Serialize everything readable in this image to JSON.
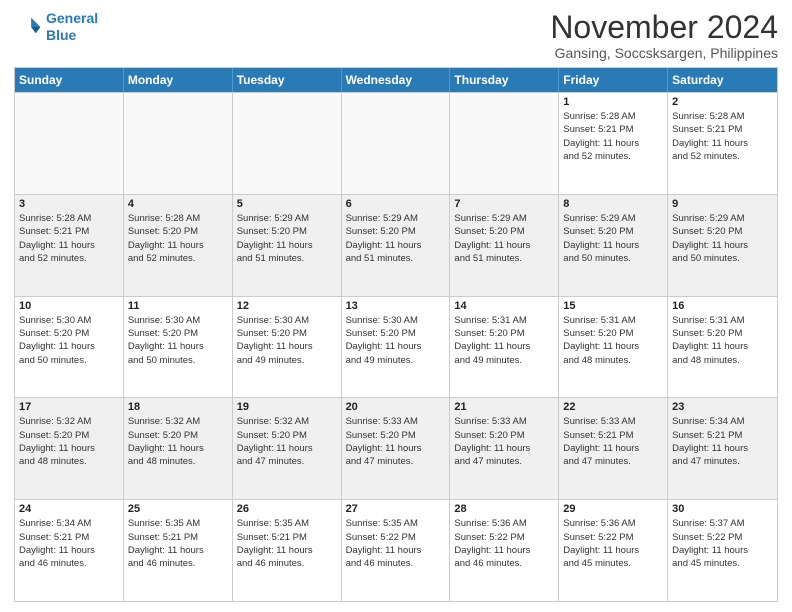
{
  "logo": {
    "line1": "General",
    "line2": "Blue"
  },
  "title": "November 2024",
  "location": "Gansing, Soccsksargen, Philippines",
  "headers": [
    "Sunday",
    "Monday",
    "Tuesday",
    "Wednesday",
    "Thursday",
    "Friday",
    "Saturday"
  ],
  "weeks": [
    [
      {
        "day": "",
        "info": "",
        "empty": true
      },
      {
        "day": "",
        "info": "",
        "empty": true
      },
      {
        "day": "",
        "info": "",
        "empty": true
      },
      {
        "day": "",
        "info": "",
        "empty": true
      },
      {
        "day": "",
        "info": "",
        "empty": true
      },
      {
        "day": "1",
        "info": "Sunrise: 5:28 AM\nSunset: 5:21 PM\nDaylight: 11 hours\nand 52 minutes.",
        "empty": false
      },
      {
        "day": "2",
        "info": "Sunrise: 5:28 AM\nSunset: 5:21 PM\nDaylight: 11 hours\nand 52 minutes.",
        "empty": false
      }
    ],
    [
      {
        "day": "3",
        "info": "Sunrise: 5:28 AM\nSunset: 5:21 PM\nDaylight: 11 hours\nand 52 minutes.",
        "empty": false
      },
      {
        "day": "4",
        "info": "Sunrise: 5:28 AM\nSunset: 5:20 PM\nDaylight: 11 hours\nand 52 minutes.",
        "empty": false
      },
      {
        "day": "5",
        "info": "Sunrise: 5:29 AM\nSunset: 5:20 PM\nDaylight: 11 hours\nand 51 minutes.",
        "empty": false
      },
      {
        "day": "6",
        "info": "Sunrise: 5:29 AM\nSunset: 5:20 PM\nDaylight: 11 hours\nand 51 minutes.",
        "empty": false
      },
      {
        "day": "7",
        "info": "Sunrise: 5:29 AM\nSunset: 5:20 PM\nDaylight: 11 hours\nand 51 minutes.",
        "empty": false
      },
      {
        "day": "8",
        "info": "Sunrise: 5:29 AM\nSunset: 5:20 PM\nDaylight: 11 hours\nand 50 minutes.",
        "empty": false
      },
      {
        "day": "9",
        "info": "Sunrise: 5:29 AM\nSunset: 5:20 PM\nDaylight: 11 hours\nand 50 minutes.",
        "empty": false
      }
    ],
    [
      {
        "day": "10",
        "info": "Sunrise: 5:30 AM\nSunset: 5:20 PM\nDaylight: 11 hours\nand 50 minutes.",
        "empty": false
      },
      {
        "day": "11",
        "info": "Sunrise: 5:30 AM\nSunset: 5:20 PM\nDaylight: 11 hours\nand 50 minutes.",
        "empty": false
      },
      {
        "day": "12",
        "info": "Sunrise: 5:30 AM\nSunset: 5:20 PM\nDaylight: 11 hours\nand 49 minutes.",
        "empty": false
      },
      {
        "day": "13",
        "info": "Sunrise: 5:30 AM\nSunset: 5:20 PM\nDaylight: 11 hours\nand 49 minutes.",
        "empty": false
      },
      {
        "day": "14",
        "info": "Sunrise: 5:31 AM\nSunset: 5:20 PM\nDaylight: 11 hours\nand 49 minutes.",
        "empty": false
      },
      {
        "day": "15",
        "info": "Sunrise: 5:31 AM\nSunset: 5:20 PM\nDaylight: 11 hours\nand 48 minutes.",
        "empty": false
      },
      {
        "day": "16",
        "info": "Sunrise: 5:31 AM\nSunset: 5:20 PM\nDaylight: 11 hours\nand 48 minutes.",
        "empty": false
      }
    ],
    [
      {
        "day": "17",
        "info": "Sunrise: 5:32 AM\nSunset: 5:20 PM\nDaylight: 11 hours\nand 48 minutes.",
        "empty": false
      },
      {
        "day": "18",
        "info": "Sunrise: 5:32 AM\nSunset: 5:20 PM\nDaylight: 11 hours\nand 48 minutes.",
        "empty": false
      },
      {
        "day": "19",
        "info": "Sunrise: 5:32 AM\nSunset: 5:20 PM\nDaylight: 11 hours\nand 47 minutes.",
        "empty": false
      },
      {
        "day": "20",
        "info": "Sunrise: 5:33 AM\nSunset: 5:20 PM\nDaylight: 11 hours\nand 47 minutes.",
        "empty": false
      },
      {
        "day": "21",
        "info": "Sunrise: 5:33 AM\nSunset: 5:20 PM\nDaylight: 11 hours\nand 47 minutes.",
        "empty": false
      },
      {
        "day": "22",
        "info": "Sunrise: 5:33 AM\nSunset: 5:21 PM\nDaylight: 11 hours\nand 47 minutes.",
        "empty": false
      },
      {
        "day": "23",
        "info": "Sunrise: 5:34 AM\nSunset: 5:21 PM\nDaylight: 11 hours\nand 47 minutes.",
        "empty": false
      }
    ],
    [
      {
        "day": "24",
        "info": "Sunrise: 5:34 AM\nSunset: 5:21 PM\nDaylight: 11 hours\nand 46 minutes.",
        "empty": false
      },
      {
        "day": "25",
        "info": "Sunrise: 5:35 AM\nSunset: 5:21 PM\nDaylight: 11 hours\nand 46 minutes.",
        "empty": false
      },
      {
        "day": "26",
        "info": "Sunrise: 5:35 AM\nSunset: 5:21 PM\nDaylight: 11 hours\nand 46 minutes.",
        "empty": false
      },
      {
        "day": "27",
        "info": "Sunrise: 5:35 AM\nSunset: 5:22 PM\nDaylight: 11 hours\nand 46 minutes.",
        "empty": false
      },
      {
        "day": "28",
        "info": "Sunrise: 5:36 AM\nSunset: 5:22 PM\nDaylight: 11 hours\nand 46 minutes.",
        "empty": false
      },
      {
        "day": "29",
        "info": "Sunrise: 5:36 AM\nSunset: 5:22 PM\nDaylight: 11 hours\nand 45 minutes.",
        "empty": false
      },
      {
        "day": "30",
        "info": "Sunrise: 5:37 AM\nSunset: 5:22 PM\nDaylight: 11 hours\nand 45 minutes.",
        "empty": false
      }
    ]
  ]
}
